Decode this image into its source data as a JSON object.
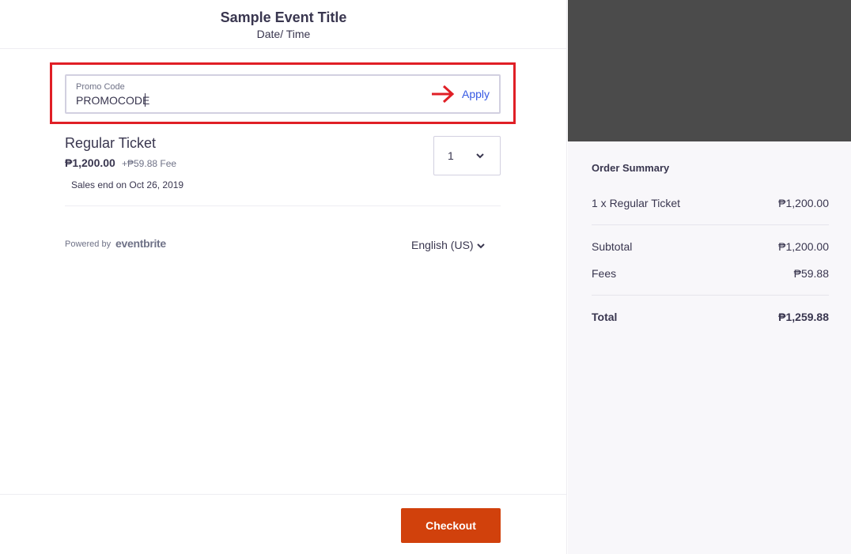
{
  "event": {
    "title": "Sample Event Title",
    "datetime": "Date/ Time"
  },
  "promo": {
    "label": "Promo Code",
    "value": "PROMOCODE",
    "apply_label": "Apply"
  },
  "ticket": {
    "name": "Regular Ticket",
    "price": "₱1,200.00",
    "fee": "+₱59.88 Fee",
    "sales_end": "Sales end on Oct 26, 2019",
    "quantity": "1"
  },
  "footer": {
    "powered_by": "Powered by",
    "brand": "eventbrite",
    "language": "English (US)",
    "checkout_label": "Checkout"
  },
  "summary": {
    "title": "Order Summary",
    "line_item_label": "1 x Regular Ticket",
    "line_item_value": "₱1,200.00",
    "subtotal_label": "Subtotal",
    "subtotal_value": "₱1,200.00",
    "fees_label": "Fees",
    "fees_value": "₱59.88",
    "total_label": "Total",
    "total_value": "₱1,259.88"
  },
  "colors": {
    "accent": "#3659e3",
    "checkout": "#d1410c",
    "highlight": "#e01f26",
    "image_placeholder": "#4b4b4b"
  },
  "icons": {
    "annotation_arrow": "arrow-right-icon",
    "dropdown": "chevron-down-icon"
  }
}
